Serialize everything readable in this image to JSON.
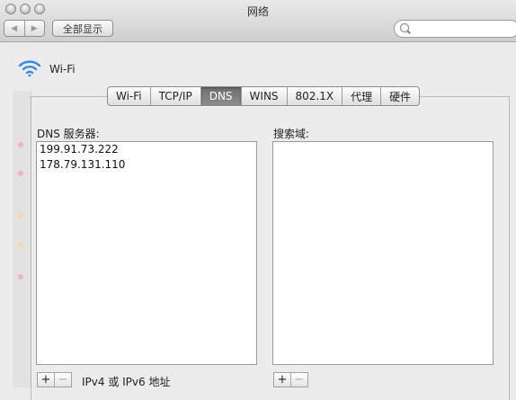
{
  "window": {
    "title": "网络"
  },
  "toolbar": {
    "back_glyph": "◀",
    "forward_glyph": "▶",
    "show_all_label": "全部显示",
    "search_placeholder": ""
  },
  "interface": {
    "name": "Wi-Fi",
    "icon": "wifi-icon"
  },
  "tabs": [
    {
      "label": "Wi-Fi",
      "active": false
    },
    {
      "label": "TCP/IP",
      "active": false
    },
    {
      "label": "DNS",
      "active": true
    },
    {
      "label": "WINS",
      "active": false
    },
    {
      "label": "802.1X",
      "active": false
    },
    {
      "label": "代理",
      "active": false
    },
    {
      "label": "硬件",
      "active": false
    }
  ],
  "dns": {
    "servers_label": "DNS 服务器:",
    "servers": [
      "199.91.73.222",
      "178.79.131.110"
    ],
    "servers_hint": "IPv4 或 IPv6 地址"
  },
  "search_domains": {
    "label": "搜索域:",
    "items": []
  },
  "buttons": {
    "add": "+",
    "remove": "−"
  },
  "colors": {
    "active_tab": "#7a7a7a",
    "wifi_blue": "#3a88e0"
  }
}
